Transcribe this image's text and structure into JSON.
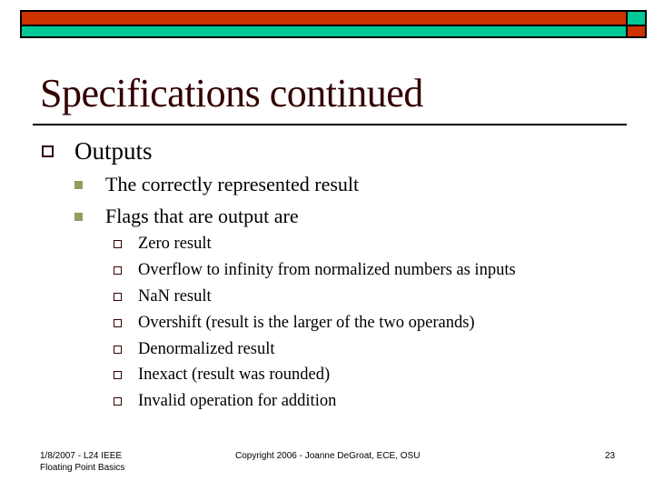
{
  "theme": {
    "bar_red": "#cc3300",
    "bar_teal": "#00c897",
    "title_color": "#330000",
    "bullet_l1_color": "#330000",
    "bullet_l2_color": "#999966",
    "bullet_l3_color": "#330000"
  },
  "slide": {
    "title": "Specifications continued",
    "bullets": [
      {
        "icon": "hollow-square-bullet",
        "text": "Outputs",
        "children": [
          {
            "icon": "filled-square-bullet",
            "text": "The correctly represented result"
          },
          {
            "icon": "filled-square-bullet",
            "text": "Flags that are output are",
            "children": [
              {
                "icon": "hollow-square-bullet",
                "text": "Zero result"
              },
              {
                "icon": "hollow-square-bullet",
                "text": "Overflow to infinity from normalized numbers as inputs"
              },
              {
                "icon": "hollow-square-bullet",
                "text": "NaN result"
              },
              {
                "icon": "hollow-square-bullet",
                "text": "Overshift (result is the larger of the two operands)"
              },
              {
                "icon": "hollow-square-bullet",
                "text": "Denormalized result"
              },
              {
                "icon": "hollow-square-bullet",
                "text": "Inexact (result was rounded)"
              },
              {
                "icon": "hollow-square-bullet",
                "text": "Invalid operation for addition"
              }
            ]
          }
        ]
      }
    ]
  },
  "footer": {
    "left_line1": "1/8/2007 - L24 IEEE",
    "left_line2": "Floating Point Basics",
    "center": "Copyright 2006 - Joanne DeGroat, ECE, OSU",
    "page_number": "23"
  }
}
